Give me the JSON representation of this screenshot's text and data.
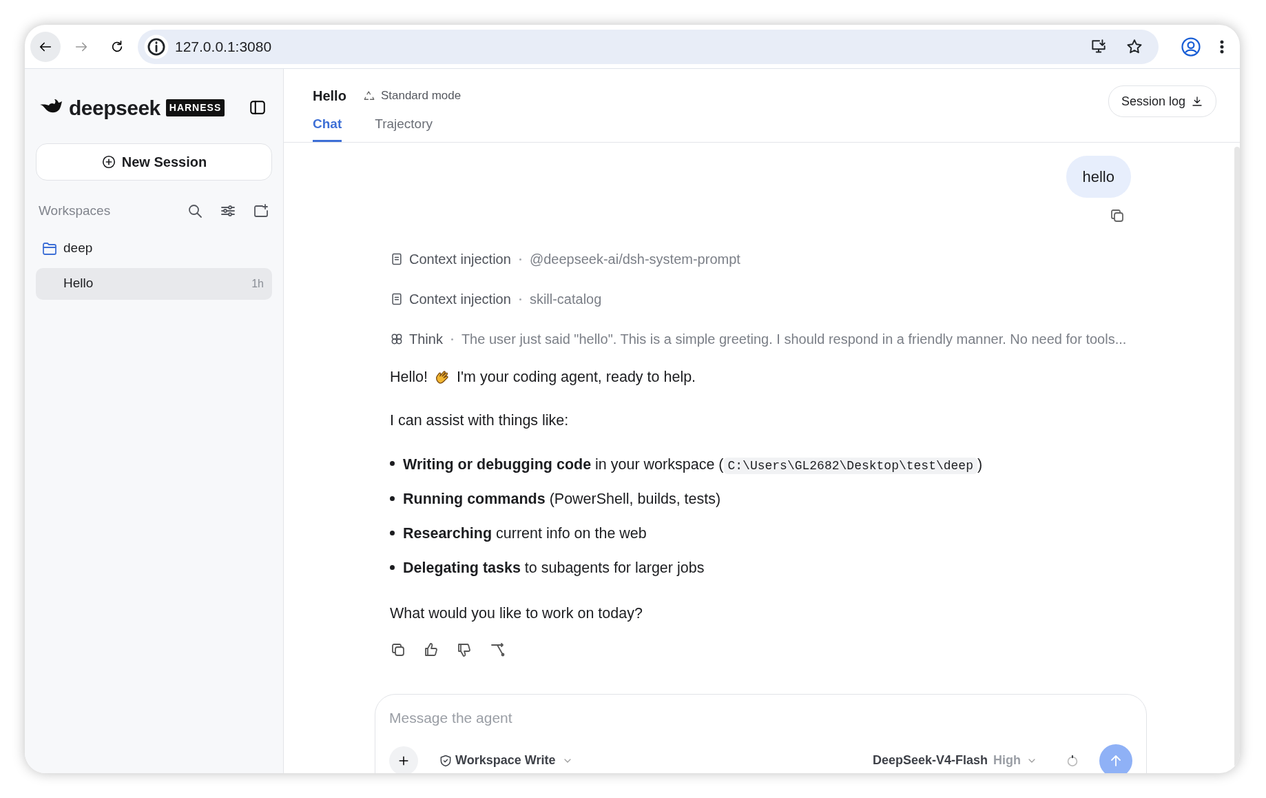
{
  "browser": {
    "url": "127.0.0.1:3080"
  },
  "sidebar": {
    "brand": "deepseek",
    "brand_badge": "HARNESS",
    "new_session": "New Session",
    "workspaces_label": "Workspaces",
    "workspaces": [
      {
        "name": "deep",
        "sessions": [
          {
            "title": "Hello",
            "age": "1h",
            "selected": true
          }
        ]
      }
    ]
  },
  "header": {
    "title": "Hello",
    "mode": "Standard mode",
    "session_log": "Session log",
    "tabs": [
      {
        "label": "Chat",
        "selected": true
      },
      {
        "label": "Trajectory",
        "selected": false
      }
    ]
  },
  "conversation": {
    "user_message": "hello",
    "steps": [
      {
        "kind": "context",
        "label": "Context injection",
        "detail": "@deepseek-ai/dsh-system-prompt"
      },
      {
        "kind": "context",
        "label": "Context injection",
        "detail": "skill-catalog"
      },
      {
        "kind": "think",
        "label": "Think",
        "detail": "The user just said \"hello\". This is a simple greeting. I should respond in a friendly manner. No need for tools..."
      }
    ],
    "reply": [
      {
        "kind": "greeting",
        "before": "Hello!",
        "after": "I'm your coding agent, ready to help."
      },
      {
        "kind": "paragraph",
        "text": "I can assist with things like:"
      },
      {
        "kind": "list",
        "items": [
          {
            "text": "**Writing or debugging code** in your workspace (",
            "code": "C:\\Users\\GL2682\\Desktop\\test\\deep",
            "after": ")"
          },
          {
            "text": "**Running commands** (PowerShell, builds, tests)"
          },
          {
            "text": "**Researching** current info on the web"
          },
          {
            "text": "**Delegating tasks** to subagents for larger jobs"
          }
        ]
      },
      {
        "kind": "paragraph",
        "text": "What would you like to work on today?"
      }
    ]
  },
  "composer": {
    "placeholder": "Message the agent",
    "permission": "Workspace Write",
    "model": "DeepSeek-V4-Flash",
    "effort": "High"
  }
}
